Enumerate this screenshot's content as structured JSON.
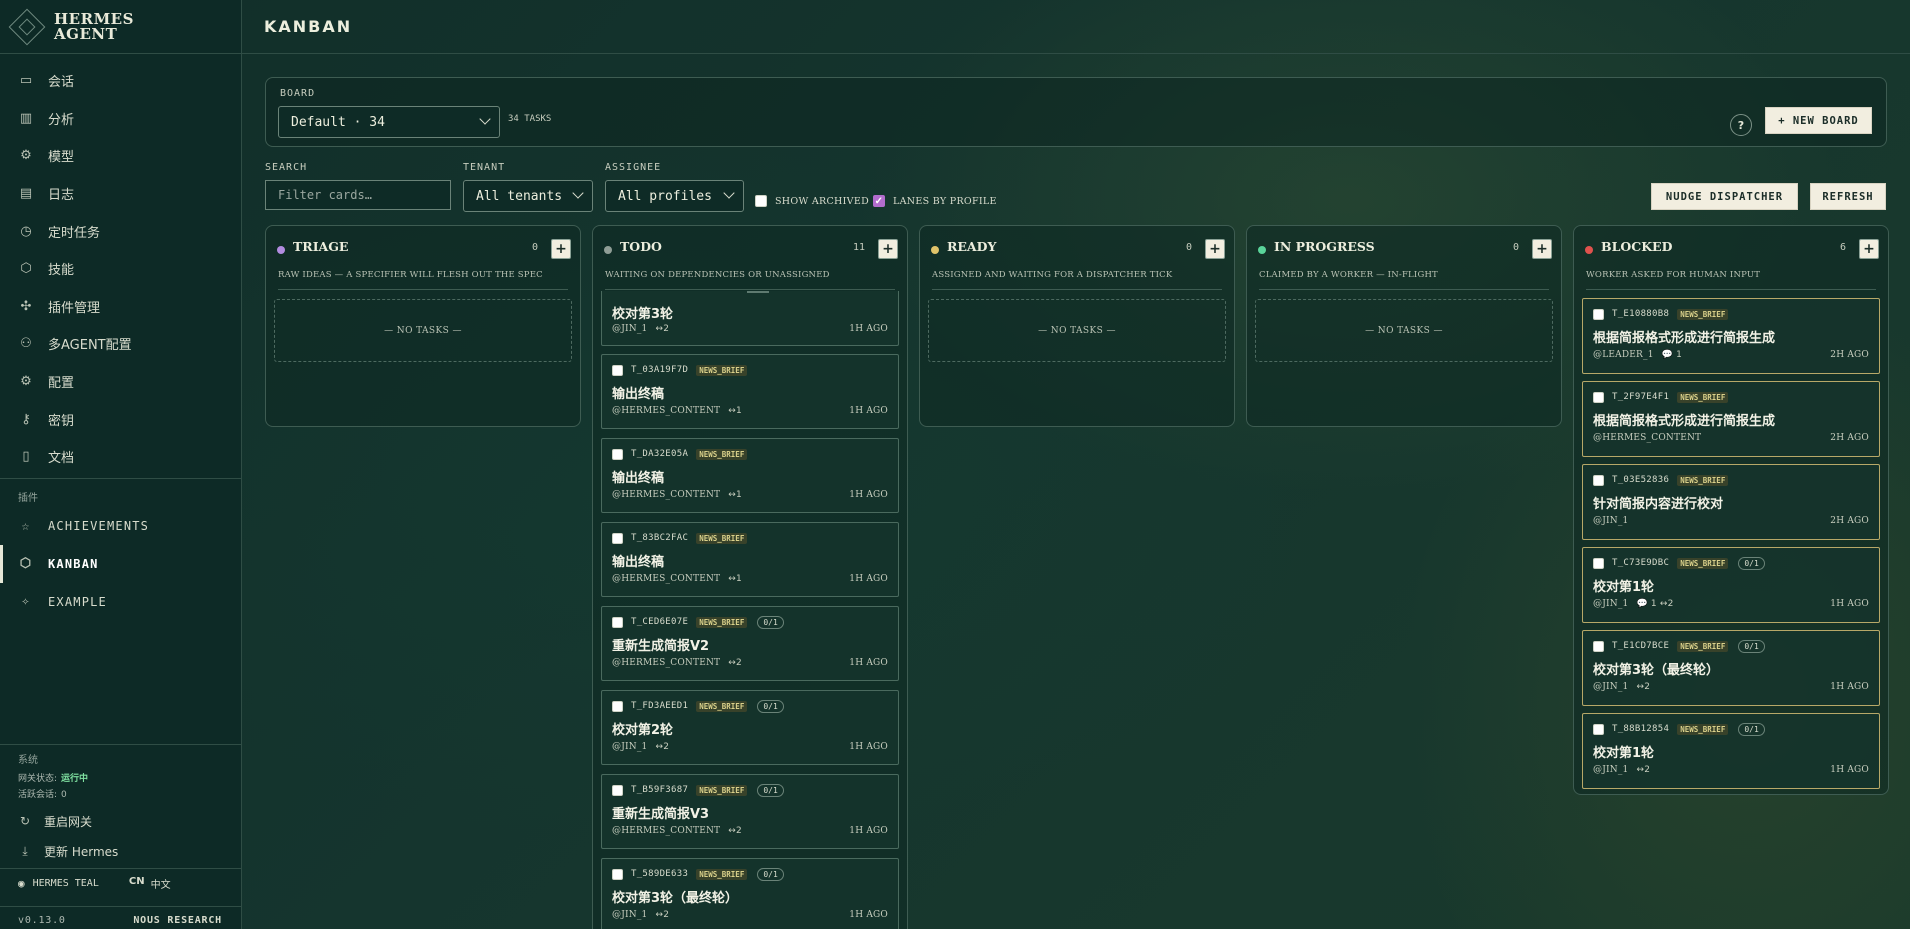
{
  "brand": {
    "line1": "HERMES",
    "line2": "AGENT"
  },
  "nav": [
    {
      "label": "会话",
      "icon": "chat-icon",
      "glyph": "▭"
    },
    {
      "label": "分析",
      "icon": "analytics-icon",
      "glyph": "▥"
    },
    {
      "label": "模型",
      "icon": "model-icon",
      "glyph": "⚙"
    },
    {
      "label": "日志",
      "icon": "log-icon",
      "glyph": "▤"
    },
    {
      "label": "定时任务",
      "icon": "clock-icon",
      "glyph": "◷"
    },
    {
      "label": "技能",
      "icon": "skill-icon",
      "glyph": "⬡"
    },
    {
      "label": "插件管理",
      "icon": "plugin-icon",
      "glyph": "✣"
    },
    {
      "label": "多AGENT配置",
      "icon": "users-icon",
      "glyph": "⚇"
    },
    {
      "label": "配置",
      "icon": "settings-icon",
      "glyph": "⚙"
    },
    {
      "label": "密钥",
      "icon": "key-icon",
      "glyph": "⚷"
    },
    {
      "label": "文档",
      "icon": "book-icon",
      "glyph": "▯"
    }
  ],
  "plugins_label": "插件",
  "plugins": [
    {
      "label": "ACHIEVEMENTS",
      "icon": "star-icon",
      "glyph": "☆"
    },
    {
      "label": "KANBAN",
      "icon": "kanban-icon",
      "glyph": "⬡"
    },
    {
      "label": "EXAMPLE",
      "icon": "sparkle-icon",
      "glyph": "✧"
    }
  ],
  "system": {
    "title": "系统",
    "gateway_label": "网关状态:",
    "gateway_value": "运行中",
    "sessions_label": "活跃会话:",
    "sessions_value": "0",
    "restart": "重启网关",
    "update": "更新 Hermes"
  },
  "footer": {
    "theme": "HERMES TEAL",
    "lang_code": "CN",
    "lang_name": "中文",
    "version": "v0.13.0",
    "org": "NOUS RESEARCH"
  },
  "header": {
    "title": "KANBAN"
  },
  "board": {
    "label": "BOARD",
    "selected": "Default · 34",
    "task_count": "34 TASKS",
    "help": "?",
    "new_board": "+ NEW BOARD"
  },
  "filters": {
    "search_label": "SEARCH",
    "search_placeholder": "Filter cards…",
    "tenant_label": "TENANT",
    "tenant_value": "All tenants",
    "assignee_label": "ASSIGNEE",
    "assignee_value": "All profiles",
    "show_archived": "SHOW ARCHIVED",
    "lanes_by_profile": "LANES BY PROFILE",
    "nudge": "NUDGE DISPATCHER",
    "refresh": "REFRESH"
  },
  "colors": {
    "triage": "#b28ce0",
    "todo": "#8f9d96",
    "ready": "#e0c46a",
    "in_progress": "#5ad49a",
    "blocked": "#e0524d"
  },
  "columns": {
    "triage": {
      "title": "TRIAGE",
      "count": "0",
      "desc": "RAW IDEAS — A SPECIFIER WILL FLESH OUT THE SPEC",
      "empty": "— NO TASKS —"
    },
    "todo": {
      "title": "TODO",
      "count": "11",
      "desc": "WAITING ON DEPENDENCIES OR UNASSIGNED"
    },
    "ready": {
      "title": "READY",
      "count": "0",
      "desc": "ASSIGNED AND WAITING FOR A DISPATCHER TICK",
      "empty": "— NO TASKS —"
    },
    "in_progress": {
      "title": "IN PROGRESS",
      "count": "0",
      "desc": "CLAIMED BY A WORKER — IN-FLIGHT",
      "empty": "— NO TASKS —"
    },
    "blocked": {
      "title": "BLOCKED",
      "count": "6",
      "desc": "WORKER ASKED FOR HUMAN INPUT"
    }
  },
  "todo_cut": {
    "title": "校对第3轮",
    "assignee": "@JIN_1",
    "meta": "↔2",
    "age": "1H AGO"
  },
  "todo_cards": [
    {
      "id": "T_03A19F7D",
      "tag": "NEWS_BRIEF",
      "title": "输出终稿",
      "assignee": "@HERMES_CONTENT",
      "meta": "↔1",
      "age": "1H AGO"
    },
    {
      "id": "T_DA32E05A",
      "tag": "NEWS_BRIEF",
      "title": "输出终稿",
      "assignee": "@HERMES_CONTENT",
      "meta": "↔1",
      "age": "1H AGO"
    },
    {
      "id": "T_83BC2FAC",
      "tag": "NEWS_BRIEF",
      "title": "输出终稿",
      "assignee": "@HERMES_CONTENT",
      "meta": "↔1",
      "age": "1H AGO"
    },
    {
      "id": "T_CED6E07E",
      "tag": "NEWS_BRIEF",
      "progress": "0/1",
      "title": "重新生成简报V2",
      "assignee": "@HERMES_CONTENT",
      "meta": "↔2",
      "age": "1H AGO"
    },
    {
      "id": "T_FD3AEED1",
      "tag": "NEWS_BRIEF",
      "progress": "0/1",
      "title": "校对第2轮",
      "assignee": "@JIN_1",
      "meta": "↔2",
      "age": "1H AGO"
    },
    {
      "id": "T_B59F3687",
      "tag": "NEWS_BRIEF",
      "progress": "0/1",
      "title": "重新生成简报V3",
      "assignee": "@HERMES_CONTENT",
      "meta": "↔2",
      "age": "1H AGO"
    },
    {
      "id": "T_589DE633",
      "tag": "NEWS_BRIEF",
      "progress": "0/1",
      "title": "校对第3轮（最终轮）",
      "assignee": "@JIN_1",
      "meta": "↔2",
      "age": "1H AGO"
    }
  ],
  "blocked_cards": [
    {
      "id": "T_E10880B8",
      "tag": "NEWS_BRIEF",
      "title": "根据简报格式形成进行简报生成",
      "assignee": "@LEADER_1",
      "meta": "💬 1",
      "age": "2H AGO"
    },
    {
      "id": "T_2F97E4F1",
      "tag": "NEWS_BRIEF",
      "title": "根据简报格式形成进行简报生成",
      "assignee": "@HERMES_CONTENT",
      "meta": "",
      "age": "2H AGO"
    },
    {
      "id": "T_03E52836",
      "tag": "NEWS_BRIEF",
      "title": "针对简报内容进行校对",
      "assignee": "@JIN_1",
      "meta": "",
      "age": "2H AGO"
    },
    {
      "id": "T_C73E9DBC",
      "tag": "NEWS_BRIEF",
      "progress": "0/1",
      "title": "校对第1轮",
      "assignee": "@JIN_1",
      "meta": "💬 1  ↔2",
      "age": "1H AGO"
    },
    {
      "id": "T_E1CD7BCE",
      "tag": "NEWS_BRIEF",
      "progress": "0/1",
      "title": "校对第3轮（最终轮）",
      "assignee": "@JIN_1",
      "meta": "↔2",
      "age": "1H AGO"
    },
    {
      "id": "T_88B12854",
      "tag": "NEWS_BRIEF",
      "progress": "0/1",
      "title": "校对第1轮",
      "assignee": "@JIN_1",
      "meta": "↔2",
      "age": "1H AGO"
    }
  ]
}
